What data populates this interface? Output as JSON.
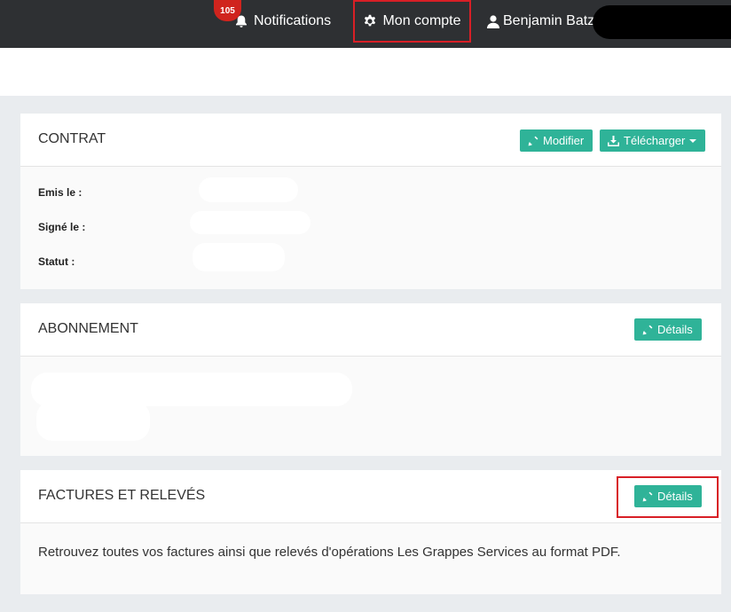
{
  "topbar": {
    "notifications_count": "105",
    "notifications_label": "Notifications",
    "account_label": "Mon compte",
    "user_name": "Benjamin Batz"
  },
  "contrat": {
    "title": "CONTRAT",
    "modify_label": "Modifier",
    "download_label": "Télécharger",
    "fields": [
      {
        "label": "Emis le :"
      },
      {
        "label": "Signé le :"
      },
      {
        "label": "Statut :"
      }
    ]
  },
  "abonnement": {
    "title": "ABONNEMENT",
    "details_label": "Détails"
  },
  "factures": {
    "title": "FACTURES ET RELEVÉS",
    "details_label": "Détails",
    "description": "Retrouvez toutes vos factures ainsi que relevés d'opérations Les Grappes Services au format PDF."
  },
  "colors": {
    "topbar": "#2e3033",
    "accent": "#2fb398",
    "highlight": "#d81f26",
    "badge": "#d0241e"
  },
  "icons": [
    "bell-icon",
    "gear-icon",
    "user-icon",
    "pencil-icon",
    "download-icon",
    "caret-down-icon"
  ]
}
